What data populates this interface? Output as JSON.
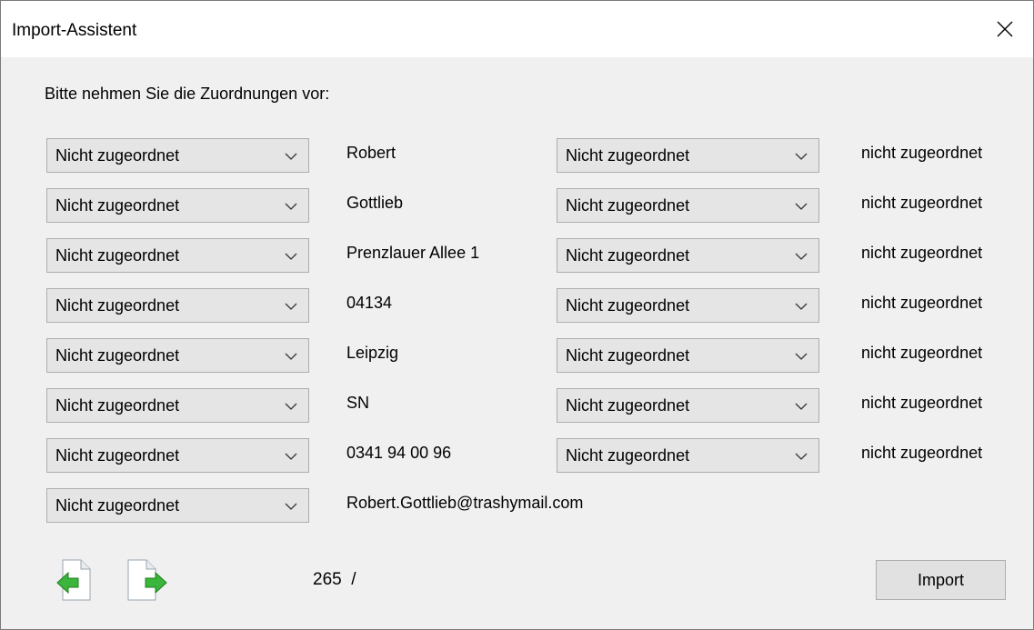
{
  "window": {
    "title": "Import-Assistent"
  },
  "instruction": "Bitte nehmen Sie die Zuordnungen vor:",
  "rows": [
    {
      "left_select": "Nicht zugeordnet",
      "left_value": "Robert",
      "right_select": "Nicht zugeordnet",
      "right_value": "nicht zugeordnet"
    },
    {
      "left_select": "Nicht zugeordnet",
      "left_value": "Gottlieb",
      "right_select": "Nicht zugeordnet",
      "right_value": "nicht zugeordnet"
    },
    {
      "left_select": "Nicht zugeordnet",
      "left_value": "Prenzlauer Allee 1",
      "right_select": "Nicht zugeordnet",
      "right_value": "nicht zugeordnet"
    },
    {
      "left_select": "Nicht zugeordnet",
      "left_value": "04134",
      "right_select": "Nicht zugeordnet",
      "right_value": "nicht zugeordnet"
    },
    {
      "left_select": "Nicht zugeordnet",
      "left_value": "Leipzig",
      "right_select": "Nicht zugeordnet",
      "right_value": "nicht zugeordnet"
    },
    {
      "left_select": "Nicht zugeordnet",
      "left_value": "SN",
      "right_select": "Nicht zugeordnet",
      "right_value": "nicht zugeordnet"
    },
    {
      "left_select": "Nicht zugeordnet",
      "left_value": "0341 94 00 96",
      "right_select": "Nicht zugeordnet",
      "right_value": "nicht zugeordnet"
    },
    {
      "left_select": "Nicht zugeordnet",
      "left_value": "Robert.Gottlieb@trashymail.com"
    }
  ],
  "footer": {
    "counter": "265  /",
    "import_label": "Import",
    "prev_icon": "previous-page-icon",
    "next_icon": "next-page-icon"
  },
  "colors": {
    "arrow_green": "#3cb53c",
    "button_bg": "#e1e1e1",
    "combo_bg": "#e5e5e5"
  }
}
